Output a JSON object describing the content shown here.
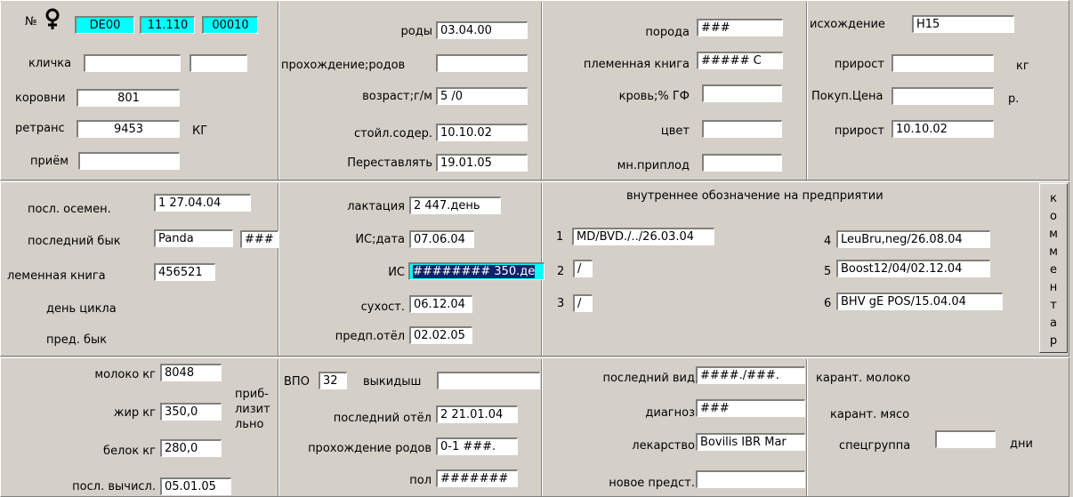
{
  "section1": {
    "col1": {
      "no_label": "№",
      "sex_icon": "female-symbol-icon",
      "id_country": "DE00",
      "id_part2": "11.110",
      "id_part3": "00010",
      "name_label": "кличка",
      "name_value": "",
      "name_value2": "",
      "barn_label": "коровни",
      "barn_value": "801",
      "transp_label": "ретранс",
      "transp_value": "9453",
      "transp_unit": "КГ",
      "intake_label": "приём",
      "intake_value": ""
    },
    "col2": {
      "birth_label": "роды",
      "birth_value": "03.04.00",
      "passage_label": "прохождение;родов",
      "passage_value": "",
      "age_label": "возраст;г/м",
      "age_value": "5 /0",
      "stall_label": "стойл.содер.",
      "stall_value": "10.10.02",
      "move_label": "Переставлять",
      "move_value": "19.01.05"
    },
    "col3": {
      "breed_label": "порода",
      "breed_value": "###",
      "herdbook_label": "племенная книга",
      "herdbook_value": "##### С",
      "blood_label": "кровь;% ГФ",
      "blood_value": "",
      "color_label": "цвет",
      "color_value": "",
      "multi_label": "мн.приплод",
      "multi_value": ""
    },
    "col4": {
      "origin_label": "исхождение",
      "origin_value": "Н15",
      "gain1_label": "прирост",
      "gain1_value": "",
      "gain1_unit": "кг",
      "price_label": "Покуп.Цена",
      "price_value": "",
      "price_unit": "р.",
      "gain2_label": "прирост",
      "gain2_value": "10.10.02"
    }
  },
  "section2": {
    "col1": {
      "insem_label": "посл. осемен.",
      "insem_value": "1   27.04.04",
      "bull_label": "последний бык",
      "bull_value": "Panda",
      "bull_code": "###",
      "herdbook_label": "леменная книга",
      "herdbook_value": "456521",
      "cycle_label": "день цикла",
      "prev_bull_label": "пред. бык"
    },
    "col2": {
      "lact_label": "лактация",
      "lact_value": "2  447.день",
      "ai_date_label": "ИС;дата",
      "ai_date_value": "07.06.04",
      "ai_label": "ИС",
      "ai_value": "######## 350.де",
      "dry_label": "сухост.",
      "dry_value": "06.12.04",
      "calving_label": "предп.отёл",
      "calving_value": "02.02.05"
    },
    "col3": {
      "title": "внутреннее обозначение на предприятии",
      "n1": "1",
      "v1": "MD/BVD./../26.03.04",
      "n2": "2",
      "v2": "/",
      "n3": "3",
      "v3": "/",
      "n4": "4",
      "v4": "LeuBru,neg/26.08.04",
      "n5": "5",
      "v5": "Boost12/04/02.12.04",
      "n6": "6",
      "v6": "BHV gE POS/15.04.04"
    },
    "comment_button": [
      "к",
      "о",
      "м",
      "м",
      "е",
      "н",
      "т",
      "а",
      "р"
    ]
  },
  "section3": {
    "col1": {
      "milk_label": "молоко кг",
      "milk_value": "8048",
      "fat_label": "жир кг",
      "fat_value": "350,0",
      "protein_label": "белок кг",
      "protein_value": "280,0",
      "approx_label": "приб- лизит- льно",
      "approx_line1": "приб-",
      "approx_line2": "лизит",
      "approx_line3": "льно",
      "calc_label": "посл. вычисл.",
      "calc_value": "05.01.05"
    },
    "col2": {
      "vpo_label": "ВПО",
      "vpo_value": "32",
      "abort_label": "выкидыш",
      "abort_value": "",
      "last_calv_label": "последний отёл",
      "last_calv_value": "2   21.01.04",
      "passage_label": "прохождение родов",
      "passage_value": "0-1 ###.",
      "sex_label": "пол",
      "sex_value": "#######"
    },
    "col3": {
      "last_type_label": "последний вид",
      "last_type_value": "####./###.",
      "diag_label": "диагноз",
      "diag_value": "###",
      "drug_label": "лекарство",
      "drug_value": "Bovilis IBR Mar",
      "new_label": "новое предст.",
      "new_value": ""
    },
    "col4": {
      "quar_milk_label": "карант. молоко",
      "quar_meat_label": "карант. мясо",
      "special_label": "спецгруппа",
      "special_value": "",
      "days_label": "дни"
    }
  }
}
